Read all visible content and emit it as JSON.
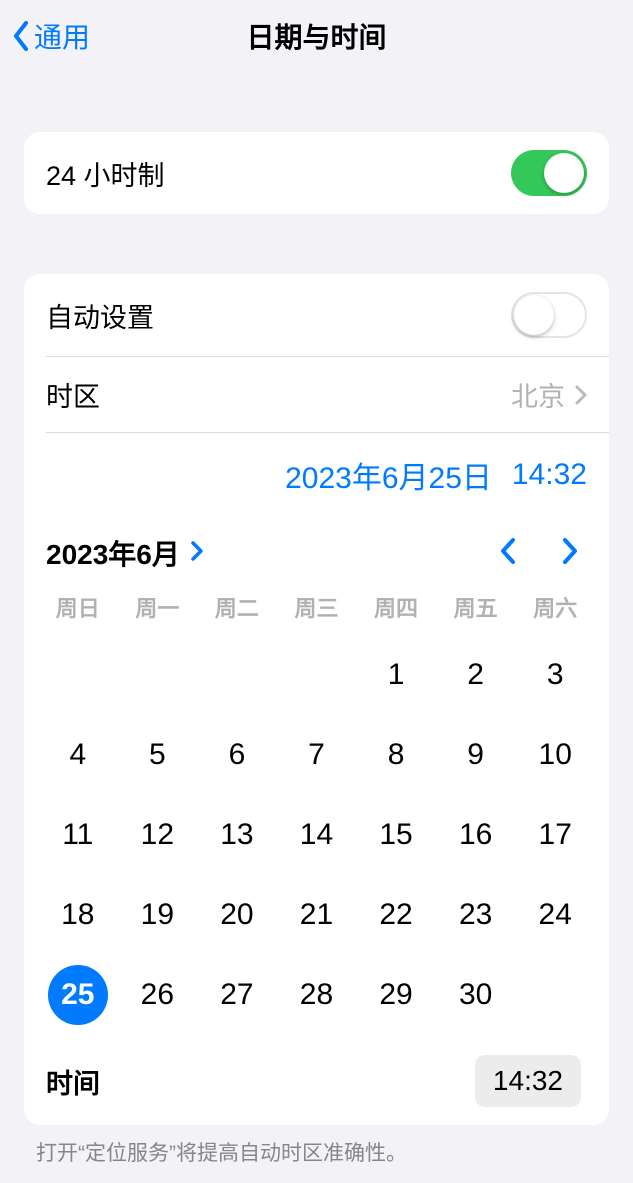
{
  "nav": {
    "back_label": "通用",
    "title": "日期与时间"
  },
  "settings": {
    "hour24": {
      "label": "24 小时制",
      "on": true
    },
    "auto_set": {
      "label": "自动设置",
      "on": false
    },
    "timezone": {
      "label": "时区",
      "value": "北京"
    }
  },
  "datetime": {
    "date_display": "2023年6月25日",
    "time_display": "14:32"
  },
  "calendar": {
    "month_label": "2023年6月",
    "weekdays": [
      "周日",
      "周一",
      "周二",
      "周三",
      "周四",
      "周五",
      "周六"
    ],
    "leading_blanks": 4,
    "days_in_month": 30,
    "selected_day": 25
  },
  "time_row": {
    "label": "时间",
    "value": "14:32"
  },
  "footer": {
    "note": "打开“定位服务”将提高自动时区准确性。"
  }
}
